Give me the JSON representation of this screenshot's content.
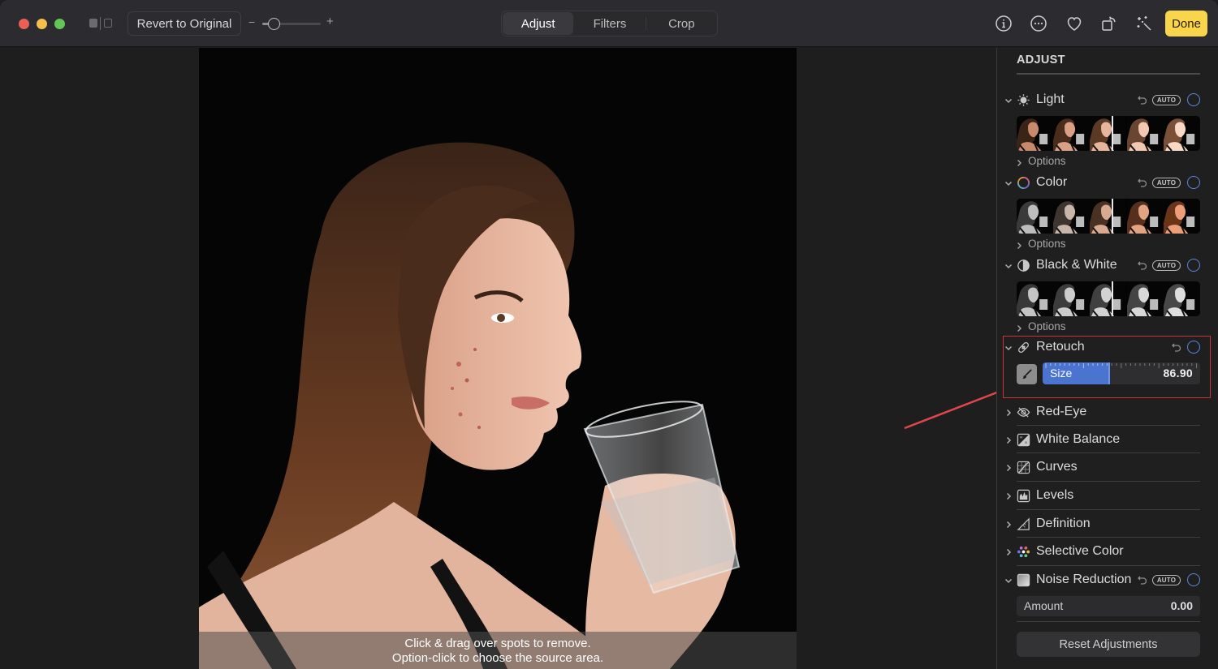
{
  "window": {
    "traffic_lights": [
      "close",
      "minimize",
      "zoom"
    ]
  },
  "toolbar": {
    "split_view_icon": "split-view-icon",
    "revert_label": "Revert to Original",
    "zoom_minus": "−",
    "zoom_plus": "+",
    "zoom_level_fraction": 0.2,
    "tabs": [
      {
        "label": "Adjust",
        "active": true
      },
      {
        "label": "Filters",
        "active": false
      },
      {
        "label": "Crop",
        "active": false
      }
    ],
    "icons": [
      "info-icon",
      "more-icon",
      "heart-icon",
      "rotate-icon",
      "magic-wand-icon"
    ],
    "done_label": "Done",
    "done_color": "#f8d54a"
  },
  "canvas": {
    "hint_line1": "Click & drag over spots to remove.",
    "hint_line2": "Option-click to choose the source area."
  },
  "sidebar": {
    "title": "ADJUST",
    "auto_label": "AUTO",
    "options_label": "Options",
    "sections": {
      "light": {
        "label": "Light",
        "icon": "sun-icon",
        "expanded": true
      },
      "color": {
        "label": "Color",
        "icon": "color-wheel-icon",
        "expanded": true
      },
      "bw": {
        "label": "Black & White",
        "icon": "half-circle-icon",
        "expanded": true
      },
      "retouch": {
        "label": "Retouch",
        "icon": "bandage-icon",
        "expanded": true,
        "size_label": "Size",
        "size_value": "86.90",
        "size_fraction": 0.43
      },
      "redeye": {
        "label": "Red-Eye",
        "icon": "eye-slash-icon"
      },
      "white_balance": {
        "label": "White Balance",
        "icon": "white-balance-icon"
      },
      "curves": {
        "label": "Curves",
        "icon": "curves-icon"
      },
      "levels": {
        "label": "Levels",
        "icon": "levels-icon"
      },
      "definition": {
        "label": "Definition",
        "icon": "triangle-icon"
      },
      "selective_color": {
        "label": "Selective Color",
        "icon": "color-dots-icon"
      },
      "noise": {
        "label": "Noise Reduction",
        "icon": "noise-icon",
        "expanded": true,
        "amount_label": "Amount",
        "amount_value": "0.00"
      }
    },
    "reset_label": "Reset Adjustments",
    "accent_color": "#5b86e5",
    "highlight_color": "#c9333a"
  }
}
